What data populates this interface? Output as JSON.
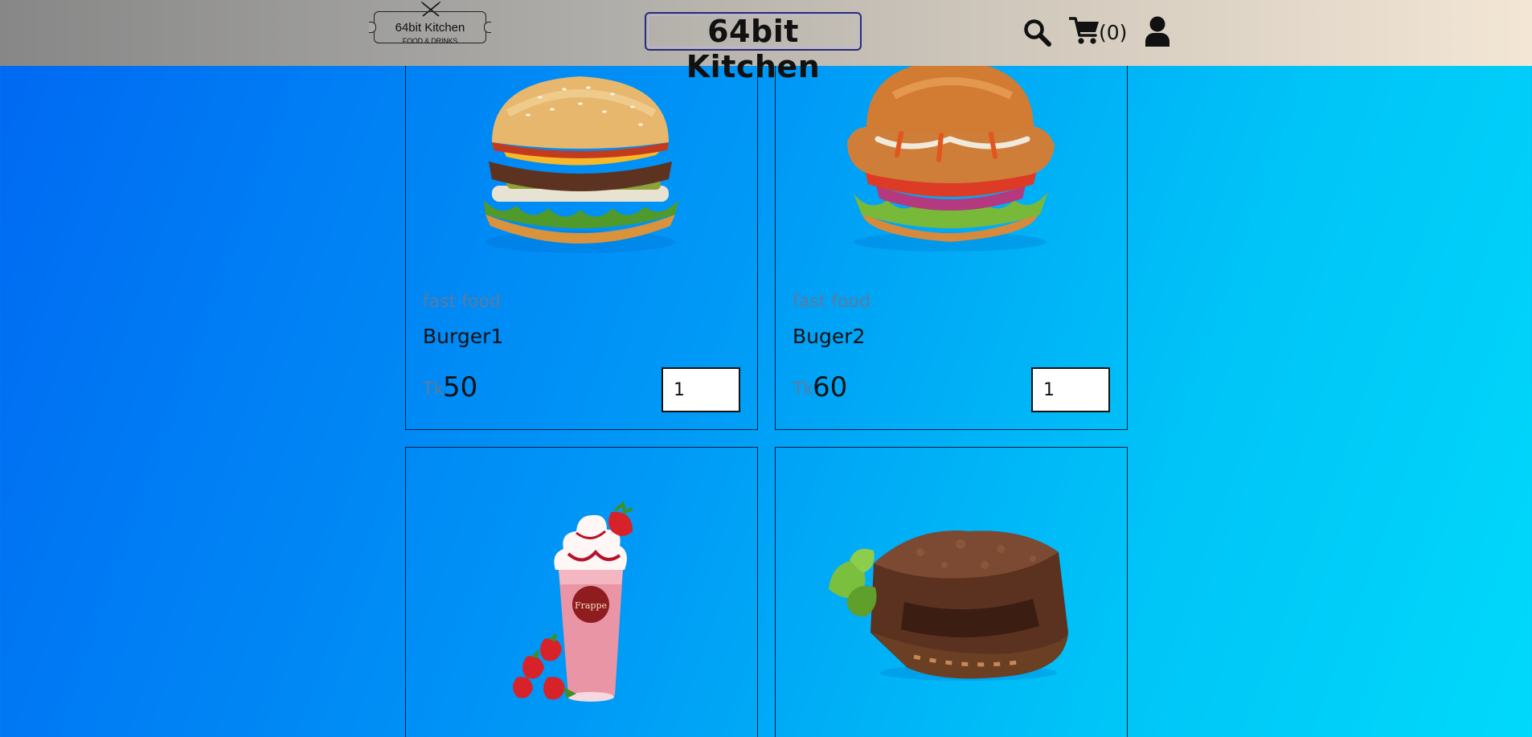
{
  "header": {
    "logo": {
      "name": "64bit Kitchen",
      "tagline": "FOOD & DRINKS"
    },
    "title": "64bit Kitchen",
    "cart_count": "(0)",
    "icons": [
      "search-icon",
      "shopping-cart-icon",
      "user-icon"
    ]
  },
  "products": [
    {
      "category": "fast food",
      "name": "Burger1",
      "currency": "Tk",
      "price": "50",
      "quantity": "1",
      "image": "burger-image"
    },
    {
      "category": "fast food",
      "name": "Buger2",
      "currency": "Tk",
      "price": "60",
      "quantity": "1",
      "image": "chicken-burger-image"
    },
    {
      "image": "strawberry-frappe-image"
    },
    {
      "image": "brownie-image"
    }
  ],
  "colors": {
    "background_start": "#0068f2",
    "background_end": "#00d9fb",
    "header_start": "#878787",
    "header_end": "#f3e6d5",
    "muted_text": "#5d7aa0"
  }
}
